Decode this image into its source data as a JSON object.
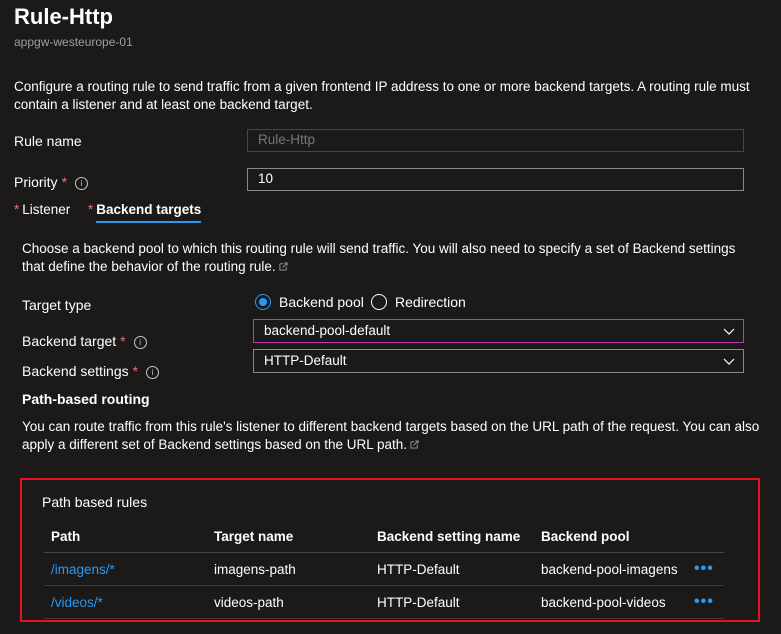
{
  "header": {
    "title": "Rule-Http",
    "subtitle": "appgw-westeurope-01"
  },
  "intro": "Configure a routing rule to send traffic from a given frontend IP address to one or more backend targets. A routing rule must contain a listener and at least one backend target.",
  "rule_name": {
    "label": "Rule name",
    "value": "Rule-Http",
    "disabled": true
  },
  "priority": {
    "label": "Priority",
    "required": "*",
    "value": "10"
  },
  "tabs": [
    {
      "label": "Listener",
      "required": "*",
      "active": false
    },
    {
      "label": "Backend targets",
      "required": "*",
      "active": true
    }
  ],
  "backend_intro": "Choose a backend pool to which this routing rule will send traffic. You will also need to specify a set of Backend settings that define the behavior of the routing rule.",
  "target_type": {
    "label": "Target type",
    "options": [
      "Backend pool",
      "Redirection"
    ],
    "selected": "Backend pool"
  },
  "backend_target": {
    "label": "Backend target",
    "required": "*",
    "value": "backend-pool-default"
  },
  "backend_settings": {
    "label": "Backend settings",
    "required": "*",
    "value": "HTTP-Default"
  },
  "path_routing": {
    "heading": "Path-based routing",
    "description": "You can route traffic from this rule's listener to different backend targets based on the URL path of the request. You can also apply a different set of Backend settings based on the URL path."
  },
  "path_rules": {
    "title": "Path based rules",
    "columns": [
      "Path",
      "Target name",
      "Backend setting name",
      "Backend pool"
    ],
    "rows": [
      {
        "path": "/imagens/*",
        "target": "imagens-path",
        "setting": "HTTP-Default",
        "pool": "backend-pool-imagens",
        "more": "•••"
      },
      {
        "path": "/videos/*",
        "target": "videos-path",
        "setting": "HTTP-Default",
        "pool": "backend-pool-videos",
        "more": "•••"
      }
    ]
  },
  "colors": {
    "background": "#1b1a19",
    "accent": "#2899f5",
    "required": "#f1707b",
    "highlight_border": "#e81123",
    "focus_border": "#c239b3"
  }
}
